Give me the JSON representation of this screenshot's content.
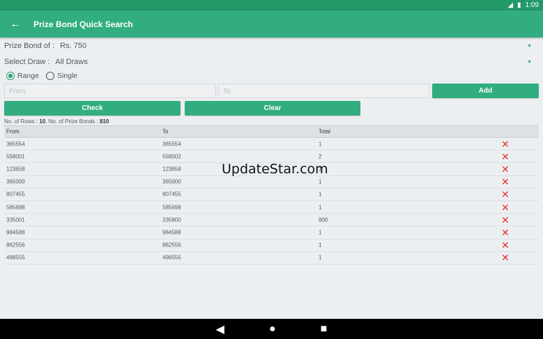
{
  "status": {
    "time": "1:09"
  },
  "appbar": {
    "title": "Prize Bond Quick Search"
  },
  "bond": {
    "label": "Prize Bond of :",
    "value": "Rs. 750"
  },
  "draw": {
    "label": "Select Draw :",
    "value": "All Draws"
  },
  "mode": {
    "range": "Range",
    "single": "Single",
    "selected": "Range"
  },
  "inputs": {
    "from_placeholder": "From",
    "to_placeholder": "To"
  },
  "buttons": {
    "add": "Add",
    "check": "Check",
    "clear": "Clear"
  },
  "info": {
    "rows_label": "No. of Rows :",
    "rows": "10",
    "bonds_label": ", No. of Prize Bonds :",
    "bonds": "810"
  },
  "table": {
    "headers": [
      "From",
      "To",
      "Total"
    ],
    "rows": [
      {
        "from": "365554",
        "to": "365554",
        "total": "1"
      },
      {
        "from": "558001",
        "to": "558002",
        "total": "2"
      },
      {
        "from": "123658",
        "to": "123658",
        "total": "1"
      },
      {
        "from": "365000",
        "to": "365000",
        "total": "1"
      },
      {
        "from": "807455",
        "to": "807455",
        "total": "1"
      },
      {
        "from": "585698",
        "to": "585698",
        "total": "1"
      },
      {
        "from": "335001",
        "to": "335800",
        "total": "800"
      },
      {
        "from": "984588",
        "to": "984588",
        "total": "1"
      },
      {
        "from": "862556",
        "to": "862556",
        "total": "1"
      },
      {
        "from": "498555",
        "to": "498555",
        "total": "1"
      }
    ]
  },
  "watermark": "UpdateStar.com"
}
